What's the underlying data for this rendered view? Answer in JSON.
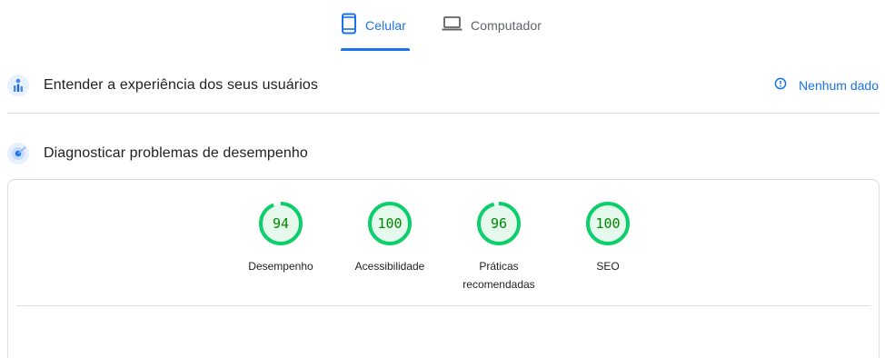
{
  "tabs": {
    "mobile": {
      "label": "Celular",
      "icon": "smartphone-icon",
      "active": true
    },
    "desktop": {
      "label": "Computador",
      "icon": "laptop-icon",
      "active": false
    }
  },
  "ux_section": {
    "title": "Entender a experiência dos seus usuários",
    "icon": "users-chart-icon",
    "no_data": {
      "label": "Nenhum dado",
      "icon": "info-icon"
    }
  },
  "diagnostics_section": {
    "title": "Diagnosticar problemas de desempenho",
    "icon": "lighthouse-icon"
  },
  "scores": [
    {
      "label": "Desempenho",
      "score": "94",
      "value": 94
    },
    {
      "label": "Acessibilidade",
      "score": "100",
      "value": 100
    },
    {
      "label": "Práticas recomendadas",
      "score": "96",
      "value": 96
    },
    {
      "label": "SEO",
      "score": "100",
      "value": 100
    }
  ],
  "colors": {
    "accent": "#1a73e8",
    "pass_ring": "#0cce6b",
    "pass_fill": "#e6f9ed",
    "pass_text": "#008800"
  }
}
